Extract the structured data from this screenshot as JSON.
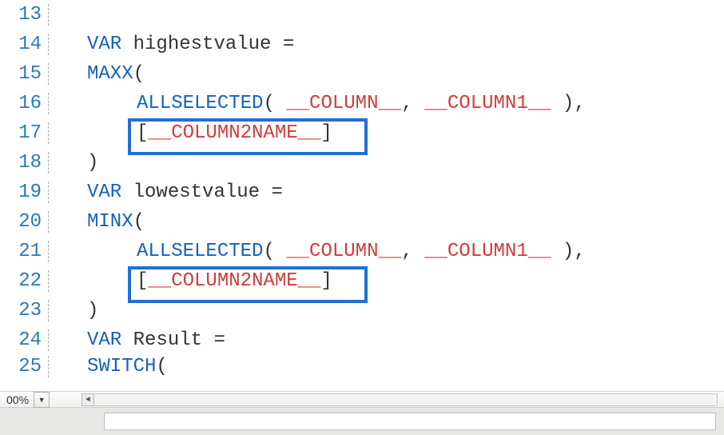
{
  "zoom": {
    "label": "00%"
  },
  "colors": {
    "accent_highlight": "#1f6fd6",
    "keyword": "#1560c0",
    "placeholder": "#d23b3b"
  },
  "lines": [
    {
      "num": "13",
      "tokens": []
    },
    {
      "num": "14",
      "tokens": [
        {
          "txt": "VAR",
          "cls": "kw"
        },
        {
          "txt": " highestvalue ",
          "cls": "plain"
        },
        {
          "txt": "=",
          "cls": "punct"
        }
      ],
      "indent": 1
    },
    {
      "num": "15",
      "tokens": [
        {
          "txt": "MAXX",
          "cls": "fn"
        },
        {
          "txt": "(",
          "cls": "punct"
        }
      ],
      "indent": 1
    },
    {
      "num": "16",
      "tokens": [
        {
          "txt": "ALLSELECTED",
          "cls": "fn"
        },
        {
          "txt": "( ",
          "cls": "punct"
        },
        {
          "txt": "__COLUMN__",
          "cls": "placeholder"
        },
        {
          "txt": ", ",
          "cls": "punct"
        },
        {
          "txt": "__COLUMN1__",
          "cls": "placeholder"
        },
        {
          "txt": " ),",
          "cls": "punct"
        }
      ],
      "indent": 2
    },
    {
      "num": "17",
      "tokens": [
        {
          "txt": "[",
          "cls": "punct"
        },
        {
          "txt": "__COLUMN2NAME__",
          "cls": "placeholder"
        },
        {
          "txt": "]",
          "cls": "punct"
        }
      ],
      "indent": 2
    },
    {
      "num": "18",
      "tokens": [
        {
          "txt": ")",
          "cls": "punct"
        }
      ],
      "indent": 1
    },
    {
      "num": "19",
      "tokens": [
        {
          "txt": "VAR",
          "cls": "kw"
        },
        {
          "txt": " lowestvalue ",
          "cls": "plain"
        },
        {
          "txt": "=",
          "cls": "punct"
        }
      ],
      "indent": 1
    },
    {
      "num": "20",
      "tokens": [
        {
          "txt": "MINX",
          "cls": "fn"
        },
        {
          "txt": "(",
          "cls": "punct"
        }
      ],
      "indent": 1
    },
    {
      "num": "21",
      "tokens": [
        {
          "txt": "ALLSELECTED",
          "cls": "fn"
        },
        {
          "txt": "( ",
          "cls": "punct"
        },
        {
          "txt": "__COLUMN__",
          "cls": "placeholder"
        },
        {
          "txt": ", ",
          "cls": "punct"
        },
        {
          "txt": "__COLUMN1__",
          "cls": "placeholder"
        },
        {
          "txt": " ),",
          "cls": "punct"
        }
      ],
      "indent": 2
    },
    {
      "num": "22",
      "tokens": [
        {
          "txt": "[",
          "cls": "punct"
        },
        {
          "txt": "__COLUMN2NAME__",
          "cls": "placeholder"
        },
        {
          "txt": "]",
          "cls": "punct"
        }
      ],
      "indent": 2
    },
    {
      "num": "23",
      "tokens": [
        {
          "txt": ")",
          "cls": "punct"
        }
      ],
      "indent": 1
    },
    {
      "num": "24",
      "tokens": [
        {
          "txt": "VAR",
          "cls": "kw"
        },
        {
          "txt": " Result ",
          "cls": "plain"
        },
        {
          "txt": "=",
          "cls": "punct"
        }
      ],
      "indent": 1
    },
    {
      "num": "25",
      "tokens": [
        {
          "txt": "SWITCH",
          "cls": "fn"
        },
        {
          "txt": "(",
          "cls": "punct"
        }
      ],
      "indent": 1,
      "last": true
    }
  ]
}
